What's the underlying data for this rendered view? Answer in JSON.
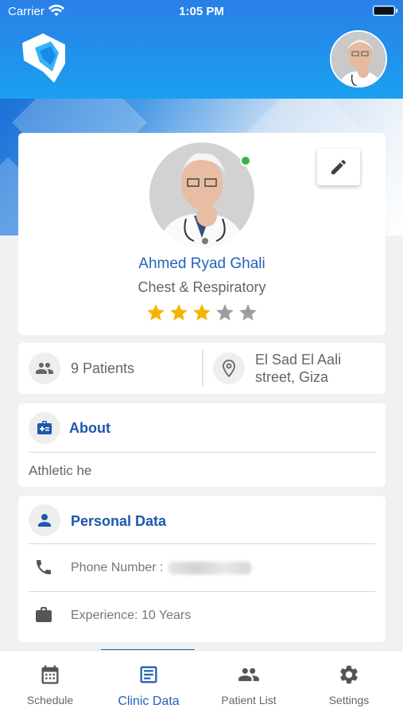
{
  "status_bar": {
    "carrier": "Carrier",
    "time": "1:05 PM"
  },
  "profile": {
    "name": "Ahmed Ryad Ghali",
    "specialty": "Chest & Respiratory",
    "rating": 3,
    "rating_max": 5
  },
  "stats": {
    "patients": "9 Patients",
    "address_line1": "El Sad El Aali",
    "address_line2": "street, Giza"
  },
  "about": {
    "title": "About",
    "text": "Athletic he"
  },
  "personal": {
    "title": "Personal Data",
    "phone_label": "Phone Number :",
    "experience_label": "Experience:",
    "experience_value": "10 Years"
  },
  "tabs": [
    {
      "label": "Schedule",
      "icon": "calendar-icon",
      "active": false
    },
    {
      "label": "Clinic Data",
      "icon": "document-icon",
      "active": true
    },
    {
      "label": "Patient List",
      "icon": "people-icon",
      "active": false
    },
    {
      "label": "Settings",
      "icon": "gear-icon",
      "active": false
    }
  ],
  "colors": {
    "primary": "#2563b8",
    "header": "#1f8cec",
    "star_on": "#f5b400",
    "star_off": "#9e9e9e",
    "online": "#35b14a"
  }
}
